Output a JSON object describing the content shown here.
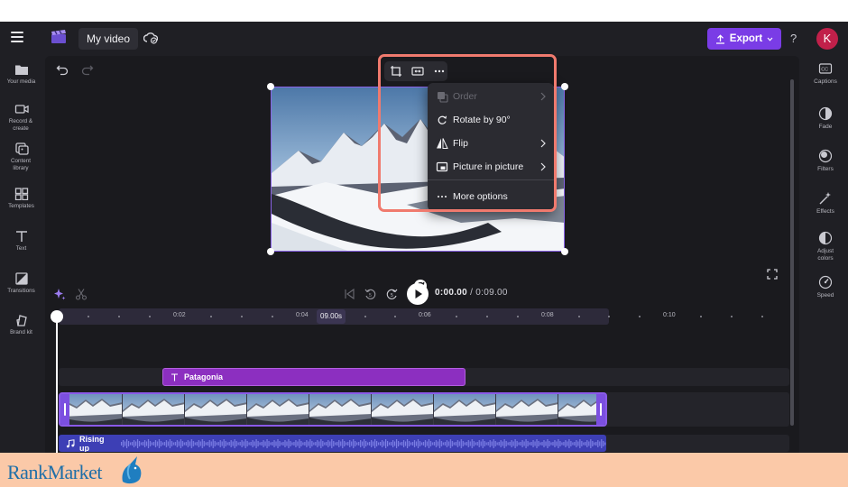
{
  "topbar": {
    "menu_icon": "hamburger-icon",
    "project_title": "My video",
    "export_label": "Export",
    "help_label": "?",
    "avatar_initial": "K"
  },
  "left_sidebar": [
    {
      "label": "Your media",
      "icon": "folder-icon"
    },
    {
      "label": "Record & create",
      "icon": "camera-icon"
    },
    {
      "label": "Content library",
      "icon": "library-icon"
    },
    {
      "label": "Templates",
      "icon": "templates-icon"
    },
    {
      "label": "Text",
      "icon": "text-icon"
    },
    {
      "label": "Transitions",
      "icon": "transitions-icon"
    },
    {
      "label": "Brand kit",
      "icon": "brand-kit-icon"
    }
  ],
  "right_sidebar": [
    {
      "label": "Captions",
      "icon": "captions-icon"
    },
    {
      "label": "Fade",
      "icon": "fade-icon"
    },
    {
      "label": "Filters",
      "icon": "filters-icon"
    },
    {
      "label": "Effects",
      "icon": "effects-icon"
    },
    {
      "label": "Adjust colors",
      "icon": "adjust-colors-icon"
    },
    {
      "label": "Speed",
      "icon": "speed-icon"
    }
  ],
  "context_menu": {
    "items": [
      {
        "label": "Order",
        "disabled": true,
        "has_submenu": true
      },
      {
        "label": "Rotate by 90°",
        "disabled": false,
        "has_submenu": false
      },
      {
        "label": "Flip",
        "disabled": false,
        "has_submenu": true
      },
      {
        "label": "Picture in picture",
        "disabled": false,
        "has_submenu": true
      },
      {
        "label": "More options",
        "disabled": false,
        "has_submenu": false
      }
    ]
  },
  "playback": {
    "current_time": "0:00.00",
    "separator": " / ",
    "total_time": "0:09.00"
  },
  "timeline": {
    "ruler_labels": [
      "0:02",
      "0:04",
      "0:06",
      "0:08",
      "0:10"
    ],
    "duration_badge": "09.00s",
    "text_clip_label": "Patagonia",
    "audio_clip_label": "Rising up"
  },
  "footer": {
    "brand": "RankMarket"
  },
  "colors": {
    "accent": "#7a3ce6",
    "highlight": "#f07a6e",
    "text_clip": "#8c2fc0",
    "audio_clip": "#3d3fb5"
  }
}
